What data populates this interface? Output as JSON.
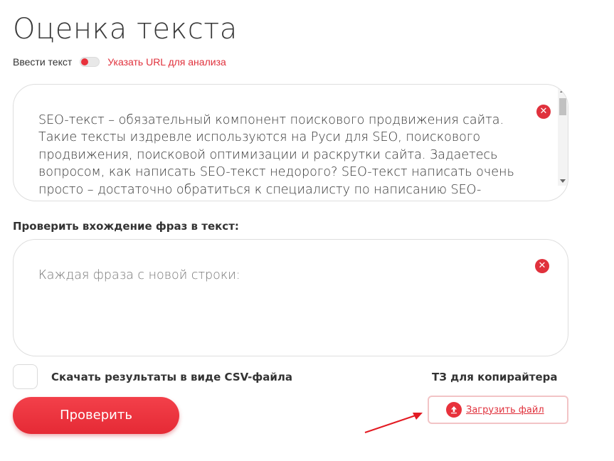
{
  "page": {
    "title": "Оценка текста"
  },
  "mode": {
    "left_label": "Ввести текст",
    "right_label": "Указать URL для анализа",
    "toggle_state": "text"
  },
  "text_input": {
    "value": "SEO-текст – обязательный компонент поискового продвижения сайта. Такие тексты издревле используются на Руси для SEO, поискового продвижения, поисковой оптимизации и раскрутки сайта. Задаетесь вопросом, как написать SEO-текст недорого? SEO-текст написать очень просто – достаточно обратиться к специалисту по написанию SEO-текстов в Москве, Санкт-Петербурге и других",
    "clear_icon": "close-icon"
  },
  "phrases": {
    "label": "Проверить вхождение фраз в текст:",
    "placeholder": "Каждая фраза с новой строки:",
    "clear_icon": "close-icon"
  },
  "csv": {
    "label": "Скачать результаты в виде CSV-файла",
    "checked": false
  },
  "tz": {
    "label": "ТЗ для копирайтера",
    "upload_label": "Загрузить файл",
    "upload_icon": "upload-icon"
  },
  "actions": {
    "check_label": "Проверить"
  },
  "colors": {
    "accent": "#e0313c",
    "button_gradient_top": "#f3404a",
    "button_gradient_bottom": "#e52a35",
    "upload_border": "#f2c4c6"
  }
}
